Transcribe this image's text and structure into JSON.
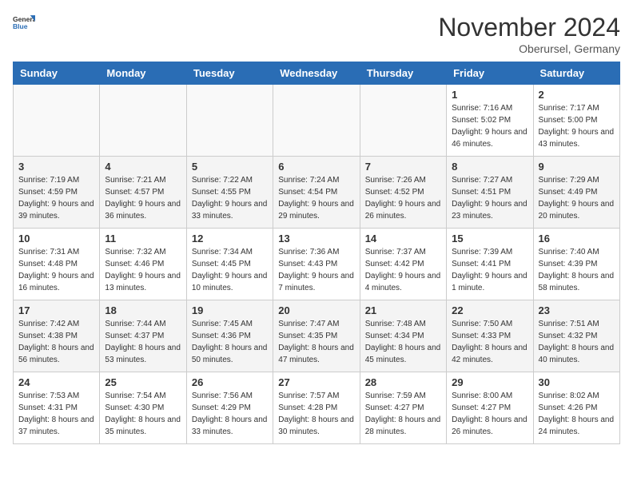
{
  "logo": {
    "text_general": "General",
    "text_blue": "Blue"
  },
  "title": "November 2024",
  "subtitle": "Oberursel, Germany",
  "weekdays": [
    "Sunday",
    "Monday",
    "Tuesday",
    "Wednesday",
    "Thursday",
    "Friday",
    "Saturday"
  ],
  "weeks": [
    [
      {
        "day": "",
        "info": ""
      },
      {
        "day": "",
        "info": ""
      },
      {
        "day": "",
        "info": ""
      },
      {
        "day": "",
        "info": ""
      },
      {
        "day": "",
        "info": ""
      },
      {
        "day": "1",
        "info": "Sunrise: 7:16 AM\nSunset: 5:02 PM\nDaylight: 9 hours and 46 minutes."
      },
      {
        "day": "2",
        "info": "Sunrise: 7:17 AM\nSunset: 5:00 PM\nDaylight: 9 hours and 43 minutes."
      }
    ],
    [
      {
        "day": "3",
        "info": "Sunrise: 7:19 AM\nSunset: 4:59 PM\nDaylight: 9 hours and 39 minutes."
      },
      {
        "day": "4",
        "info": "Sunrise: 7:21 AM\nSunset: 4:57 PM\nDaylight: 9 hours and 36 minutes."
      },
      {
        "day": "5",
        "info": "Sunrise: 7:22 AM\nSunset: 4:55 PM\nDaylight: 9 hours and 33 minutes."
      },
      {
        "day": "6",
        "info": "Sunrise: 7:24 AM\nSunset: 4:54 PM\nDaylight: 9 hours and 29 minutes."
      },
      {
        "day": "7",
        "info": "Sunrise: 7:26 AM\nSunset: 4:52 PM\nDaylight: 9 hours and 26 minutes."
      },
      {
        "day": "8",
        "info": "Sunrise: 7:27 AM\nSunset: 4:51 PM\nDaylight: 9 hours and 23 minutes."
      },
      {
        "day": "9",
        "info": "Sunrise: 7:29 AM\nSunset: 4:49 PM\nDaylight: 9 hours and 20 minutes."
      }
    ],
    [
      {
        "day": "10",
        "info": "Sunrise: 7:31 AM\nSunset: 4:48 PM\nDaylight: 9 hours and 16 minutes."
      },
      {
        "day": "11",
        "info": "Sunrise: 7:32 AM\nSunset: 4:46 PM\nDaylight: 9 hours and 13 minutes."
      },
      {
        "day": "12",
        "info": "Sunrise: 7:34 AM\nSunset: 4:45 PM\nDaylight: 9 hours and 10 minutes."
      },
      {
        "day": "13",
        "info": "Sunrise: 7:36 AM\nSunset: 4:43 PM\nDaylight: 9 hours and 7 minutes."
      },
      {
        "day": "14",
        "info": "Sunrise: 7:37 AM\nSunset: 4:42 PM\nDaylight: 9 hours and 4 minutes."
      },
      {
        "day": "15",
        "info": "Sunrise: 7:39 AM\nSunset: 4:41 PM\nDaylight: 9 hours and 1 minute."
      },
      {
        "day": "16",
        "info": "Sunrise: 7:40 AM\nSunset: 4:39 PM\nDaylight: 8 hours and 58 minutes."
      }
    ],
    [
      {
        "day": "17",
        "info": "Sunrise: 7:42 AM\nSunset: 4:38 PM\nDaylight: 8 hours and 56 minutes."
      },
      {
        "day": "18",
        "info": "Sunrise: 7:44 AM\nSunset: 4:37 PM\nDaylight: 8 hours and 53 minutes."
      },
      {
        "day": "19",
        "info": "Sunrise: 7:45 AM\nSunset: 4:36 PM\nDaylight: 8 hours and 50 minutes."
      },
      {
        "day": "20",
        "info": "Sunrise: 7:47 AM\nSunset: 4:35 PM\nDaylight: 8 hours and 47 minutes."
      },
      {
        "day": "21",
        "info": "Sunrise: 7:48 AM\nSunset: 4:34 PM\nDaylight: 8 hours and 45 minutes."
      },
      {
        "day": "22",
        "info": "Sunrise: 7:50 AM\nSunset: 4:33 PM\nDaylight: 8 hours and 42 minutes."
      },
      {
        "day": "23",
        "info": "Sunrise: 7:51 AM\nSunset: 4:32 PM\nDaylight: 8 hours and 40 minutes."
      }
    ],
    [
      {
        "day": "24",
        "info": "Sunrise: 7:53 AM\nSunset: 4:31 PM\nDaylight: 8 hours and 37 minutes."
      },
      {
        "day": "25",
        "info": "Sunrise: 7:54 AM\nSunset: 4:30 PM\nDaylight: 8 hours and 35 minutes."
      },
      {
        "day": "26",
        "info": "Sunrise: 7:56 AM\nSunset: 4:29 PM\nDaylight: 8 hours and 33 minutes."
      },
      {
        "day": "27",
        "info": "Sunrise: 7:57 AM\nSunset: 4:28 PM\nDaylight: 8 hours and 30 minutes."
      },
      {
        "day": "28",
        "info": "Sunrise: 7:59 AM\nSunset: 4:27 PM\nDaylight: 8 hours and 28 minutes."
      },
      {
        "day": "29",
        "info": "Sunrise: 8:00 AM\nSunset: 4:27 PM\nDaylight: 8 hours and 26 minutes."
      },
      {
        "day": "30",
        "info": "Sunrise: 8:02 AM\nSunset: 4:26 PM\nDaylight: 8 hours and 24 minutes."
      }
    ]
  ]
}
